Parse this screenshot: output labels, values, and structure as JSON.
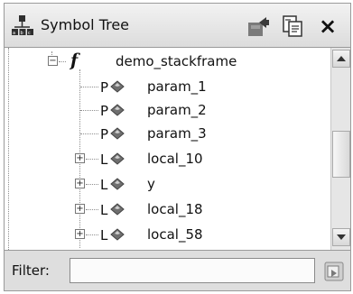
{
  "window": {
    "title": "Symbol Tree",
    "close_label": "×"
  },
  "tree": {
    "function": {
      "name": "demo_stackframe",
      "expander": "⊟"
    },
    "items": [
      {
        "kind": "param",
        "prefix": "P",
        "label": "param_1",
        "expandable": false
      },
      {
        "kind": "param",
        "prefix": "P",
        "label": "param_2",
        "expandable": false
      },
      {
        "kind": "param",
        "prefix": "P",
        "label": "param_3",
        "expandable": false
      },
      {
        "kind": "local",
        "prefix": "L",
        "label": "local_10",
        "expandable": true
      },
      {
        "kind": "local",
        "prefix": "L",
        "label": "y",
        "expandable": true
      },
      {
        "kind": "local",
        "prefix": "L",
        "label": "local_18",
        "expandable": true
      },
      {
        "kind": "local",
        "prefix": "L",
        "label": "local_58",
        "expandable": true
      }
    ]
  },
  "filter": {
    "label": "Filter:",
    "value": ""
  },
  "icons": {
    "app": "symbol-tree-icon",
    "export": "export-icon",
    "copy": "copy-icon",
    "close": "close-icon",
    "filter_clear": "filter-icon"
  },
  "colors": {
    "diamond": "#6f6f6f",
    "titlebar": "#e4e4e4",
    "filterbar": "#dedede"
  }
}
